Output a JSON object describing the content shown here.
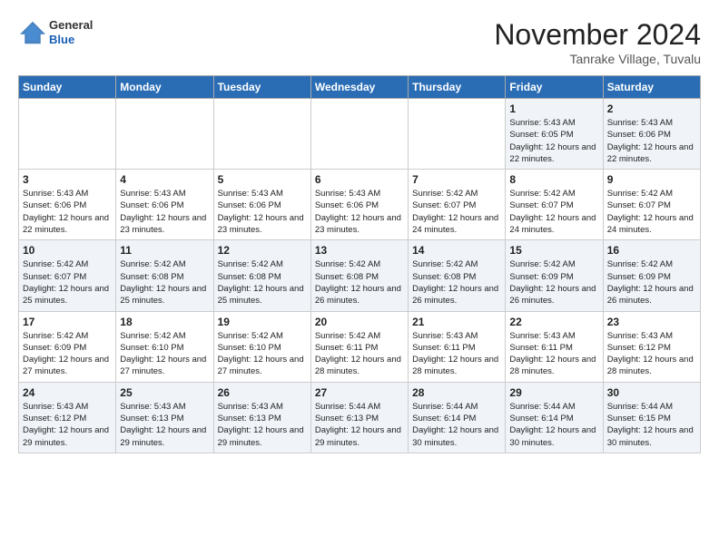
{
  "logo": {
    "general": "General",
    "blue": "Blue"
  },
  "title": "November 2024",
  "location": "Tanrake Village, Tuvalu",
  "headers": [
    "Sunday",
    "Monday",
    "Tuesday",
    "Wednesday",
    "Thursday",
    "Friday",
    "Saturday"
  ],
  "weeks": [
    [
      {
        "day": "",
        "sunrise": "",
        "sunset": "",
        "daylight": ""
      },
      {
        "day": "",
        "sunrise": "",
        "sunset": "",
        "daylight": ""
      },
      {
        "day": "",
        "sunrise": "",
        "sunset": "",
        "daylight": ""
      },
      {
        "day": "",
        "sunrise": "",
        "sunset": "",
        "daylight": ""
      },
      {
        "day": "",
        "sunrise": "",
        "sunset": "",
        "daylight": ""
      },
      {
        "day": "1",
        "sunrise": "Sunrise: 5:43 AM",
        "sunset": "Sunset: 6:05 PM",
        "daylight": "Daylight: 12 hours and 22 minutes."
      },
      {
        "day": "2",
        "sunrise": "Sunrise: 5:43 AM",
        "sunset": "Sunset: 6:06 PM",
        "daylight": "Daylight: 12 hours and 22 minutes."
      }
    ],
    [
      {
        "day": "3",
        "sunrise": "Sunrise: 5:43 AM",
        "sunset": "Sunset: 6:06 PM",
        "daylight": "Daylight: 12 hours and 22 minutes."
      },
      {
        "day": "4",
        "sunrise": "Sunrise: 5:43 AM",
        "sunset": "Sunset: 6:06 PM",
        "daylight": "Daylight: 12 hours and 23 minutes."
      },
      {
        "day": "5",
        "sunrise": "Sunrise: 5:43 AM",
        "sunset": "Sunset: 6:06 PM",
        "daylight": "Daylight: 12 hours and 23 minutes."
      },
      {
        "day": "6",
        "sunrise": "Sunrise: 5:43 AM",
        "sunset": "Sunset: 6:06 PM",
        "daylight": "Daylight: 12 hours and 23 minutes."
      },
      {
        "day": "7",
        "sunrise": "Sunrise: 5:42 AM",
        "sunset": "Sunset: 6:07 PM",
        "daylight": "Daylight: 12 hours and 24 minutes."
      },
      {
        "day": "8",
        "sunrise": "Sunrise: 5:42 AM",
        "sunset": "Sunset: 6:07 PM",
        "daylight": "Daylight: 12 hours and 24 minutes."
      },
      {
        "day": "9",
        "sunrise": "Sunrise: 5:42 AM",
        "sunset": "Sunset: 6:07 PM",
        "daylight": "Daylight: 12 hours and 24 minutes."
      }
    ],
    [
      {
        "day": "10",
        "sunrise": "Sunrise: 5:42 AM",
        "sunset": "Sunset: 6:07 PM",
        "daylight": "Daylight: 12 hours and 25 minutes."
      },
      {
        "day": "11",
        "sunrise": "Sunrise: 5:42 AM",
        "sunset": "Sunset: 6:08 PM",
        "daylight": "Daylight: 12 hours and 25 minutes."
      },
      {
        "day": "12",
        "sunrise": "Sunrise: 5:42 AM",
        "sunset": "Sunset: 6:08 PM",
        "daylight": "Daylight: 12 hours and 25 minutes."
      },
      {
        "day": "13",
        "sunrise": "Sunrise: 5:42 AM",
        "sunset": "Sunset: 6:08 PM",
        "daylight": "Daylight: 12 hours and 26 minutes."
      },
      {
        "day": "14",
        "sunrise": "Sunrise: 5:42 AM",
        "sunset": "Sunset: 6:08 PM",
        "daylight": "Daylight: 12 hours and 26 minutes."
      },
      {
        "day": "15",
        "sunrise": "Sunrise: 5:42 AM",
        "sunset": "Sunset: 6:09 PM",
        "daylight": "Daylight: 12 hours and 26 minutes."
      },
      {
        "day": "16",
        "sunrise": "Sunrise: 5:42 AM",
        "sunset": "Sunset: 6:09 PM",
        "daylight": "Daylight: 12 hours and 26 minutes."
      }
    ],
    [
      {
        "day": "17",
        "sunrise": "Sunrise: 5:42 AM",
        "sunset": "Sunset: 6:09 PM",
        "daylight": "Daylight: 12 hours and 27 minutes."
      },
      {
        "day": "18",
        "sunrise": "Sunrise: 5:42 AM",
        "sunset": "Sunset: 6:10 PM",
        "daylight": "Daylight: 12 hours and 27 minutes."
      },
      {
        "day": "19",
        "sunrise": "Sunrise: 5:42 AM",
        "sunset": "Sunset: 6:10 PM",
        "daylight": "Daylight: 12 hours and 27 minutes."
      },
      {
        "day": "20",
        "sunrise": "Sunrise: 5:42 AM",
        "sunset": "Sunset: 6:11 PM",
        "daylight": "Daylight: 12 hours and 28 minutes."
      },
      {
        "day": "21",
        "sunrise": "Sunrise: 5:43 AM",
        "sunset": "Sunset: 6:11 PM",
        "daylight": "Daylight: 12 hours and 28 minutes."
      },
      {
        "day": "22",
        "sunrise": "Sunrise: 5:43 AM",
        "sunset": "Sunset: 6:11 PM",
        "daylight": "Daylight: 12 hours and 28 minutes."
      },
      {
        "day": "23",
        "sunrise": "Sunrise: 5:43 AM",
        "sunset": "Sunset: 6:12 PM",
        "daylight": "Daylight: 12 hours and 28 minutes."
      }
    ],
    [
      {
        "day": "24",
        "sunrise": "Sunrise: 5:43 AM",
        "sunset": "Sunset: 6:12 PM",
        "daylight": "Daylight: 12 hours and 29 minutes."
      },
      {
        "day": "25",
        "sunrise": "Sunrise: 5:43 AM",
        "sunset": "Sunset: 6:13 PM",
        "daylight": "Daylight: 12 hours and 29 minutes."
      },
      {
        "day": "26",
        "sunrise": "Sunrise: 5:43 AM",
        "sunset": "Sunset: 6:13 PM",
        "daylight": "Daylight: 12 hours and 29 minutes."
      },
      {
        "day": "27",
        "sunrise": "Sunrise: 5:44 AM",
        "sunset": "Sunset: 6:13 PM",
        "daylight": "Daylight: 12 hours and 29 minutes."
      },
      {
        "day": "28",
        "sunrise": "Sunrise: 5:44 AM",
        "sunset": "Sunset: 6:14 PM",
        "daylight": "Daylight: 12 hours and 30 minutes."
      },
      {
        "day": "29",
        "sunrise": "Sunrise: 5:44 AM",
        "sunset": "Sunset: 6:14 PM",
        "daylight": "Daylight: 12 hours and 30 minutes."
      },
      {
        "day": "30",
        "sunrise": "Sunrise: 5:44 AM",
        "sunset": "Sunset: 6:15 PM",
        "daylight": "Daylight: 12 hours and 30 minutes."
      }
    ]
  ]
}
